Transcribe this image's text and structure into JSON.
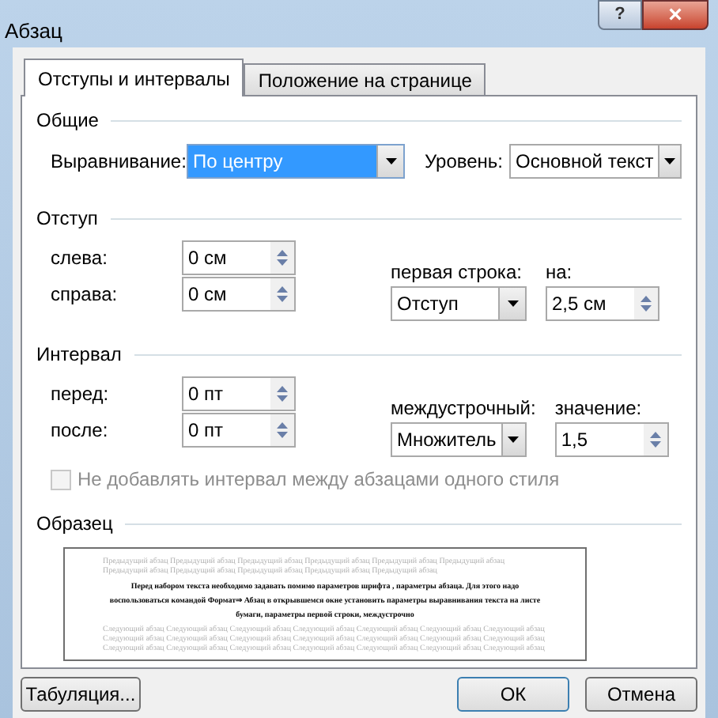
{
  "window": {
    "title": "Абзац",
    "help": "?",
    "close": "×"
  },
  "tabs": [
    {
      "label": "Отступы и интервалы",
      "selected": true
    },
    {
      "label": "Положение на странице",
      "selected": false
    }
  ],
  "general": {
    "title": "Общие",
    "alignment": {
      "label": "Выравнивание:",
      "value": "По центру",
      "focused": true
    },
    "level": {
      "label": "Уровень:",
      "value": "Основной текст"
    }
  },
  "indent": {
    "title": "Отступ",
    "left": {
      "label": "слева:",
      "value": "0 см"
    },
    "right": {
      "label": "справа:",
      "value": "0 см"
    },
    "first_line": {
      "label": "первая строка:",
      "value": "Отступ"
    },
    "by": {
      "label": "на:",
      "value": "2,5 см"
    }
  },
  "spacing": {
    "title": "Интервал",
    "before": {
      "label": "перед:",
      "value": "0 пт"
    },
    "after": {
      "label": "после:",
      "value": "0 пт"
    },
    "line_spacing": {
      "label": "междустрочный:",
      "value": "Множитель"
    },
    "at": {
      "label": "значение:",
      "value": "1,5"
    },
    "no_space_checkbox": {
      "label": "Не добавлять интервал между абзацами одного стиля",
      "checked": false,
      "disabled": true
    }
  },
  "preview": {
    "title": "Образец",
    "previous": "Предыдущий абзац Предыдущий абзац Предыдущий абзац Предыдущий абзац Предыдущий абзац Предыдущий абзац Предыдущий абзац Предыдущий абзац Предыдущий абзац Предыдущий абзац Предыдущий абзац",
    "current": "Перед набором текста необходимо задавать помимо параметров шрифта , параметры абзаца. Для этого надо воспользоваться командой Формат⇒ Абзац в открывшемся окне установить параметры выравнивания текста на листе бумаги, параметры первой строки, междустрочно",
    "next": "Следующий абзац Следующий абзац Следующий абзац Следующий абзац Следующий абзац Следующий абзац Следующий абзац Следующий абзац Следующий абзац Следующий абзац Следующий абзац Следующий абзац Следующий абзац Следующий абзац Следующий абзац Следующий абзац Следующий абзац Следующий абзац Следующий абзац Следующий абзац Следующий абзац"
  },
  "buttons": [
    {
      "label": "Табуляция...",
      "kind": "left"
    },
    {
      "label": "ОК",
      "kind": "default"
    },
    {
      "label": "Отмена",
      "kind": "normal"
    }
  ]
}
